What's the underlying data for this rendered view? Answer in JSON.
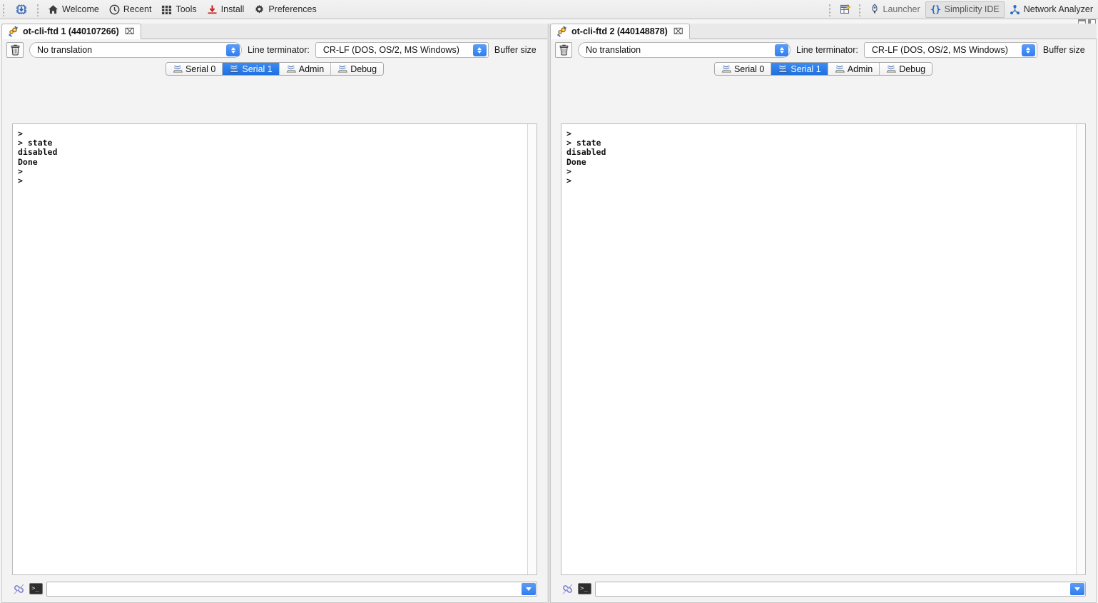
{
  "toolbar": {
    "left_items": [
      {
        "name": "chip-download",
        "label": "",
        "icon": "chip-download-icon"
      },
      {
        "name": "welcome",
        "label": "Welcome",
        "icon": "home-icon"
      },
      {
        "name": "recent",
        "label": "Recent",
        "icon": "clock-icon"
      },
      {
        "name": "tools",
        "label": "Tools",
        "icon": "grid-icon"
      },
      {
        "name": "install",
        "label": "Install",
        "icon": "download-icon"
      },
      {
        "name": "preferences",
        "label": "Preferences",
        "icon": "gear-icon"
      }
    ],
    "right_items": [
      {
        "name": "open-perspective",
        "label": "",
        "icon": "open-perspective-icon",
        "selected": false
      },
      {
        "name": "launcher",
        "label": "Launcher",
        "icon": "launcher-icon",
        "selected": false
      },
      {
        "name": "simplicity-ide",
        "label": "Simplicity IDE",
        "icon": "braces-icon",
        "selected": true
      },
      {
        "name": "network-analyzer",
        "label": "Network Analyzer",
        "icon": "network-icon",
        "selected": false
      }
    ]
  },
  "panels": [
    {
      "tab_title": "ot-cli-ftd 1 (440107266)",
      "close_glyph": "⌧",
      "translation": "No translation",
      "line_terminator_label": "Line terminator:",
      "line_terminator": "CR-LF  (DOS, OS/2, MS Windows)",
      "buffer_size_label": "Buffer size",
      "serial_tabs": [
        {
          "label": "Serial 0",
          "active": false
        },
        {
          "label": "Serial 1",
          "active": true
        },
        {
          "label": "Admin",
          "active": false
        },
        {
          "label": "Debug",
          "active": false
        }
      ],
      "terminal_lines": [
        ">",
        "> state",
        "disabled",
        "Done",
        ">",
        ">"
      ],
      "command_value": "",
      "command_placeholder": ""
    },
    {
      "tab_title": "ot-cli-ftd 2 (440148878)",
      "close_glyph": "⌧",
      "translation": "No translation",
      "line_terminator_label": "Line terminator:",
      "line_terminator": "CR-LF  (DOS, OS/2, MS Windows)",
      "buffer_size_label": "Buffer size",
      "serial_tabs": [
        {
          "label": "Serial 0",
          "active": false
        },
        {
          "label": "Serial 1",
          "active": true
        },
        {
          "label": "Admin",
          "active": false
        },
        {
          "label": "Debug",
          "active": false
        }
      ],
      "terminal_lines": [
        ">",
        "> state",
        "disabled",
        "Done",
        ">",
        ">"
      ],
      "command_value": "",
      "command_placeholder": ""
    }
  ],
  "colors": {
    "accent_blue": "#2e7ef0",
    "tab_active_blue": "#1f6fe0",
    "toolbar_bg": "#eaeaea",
    "terminal_text": "#111111"
  }
}
